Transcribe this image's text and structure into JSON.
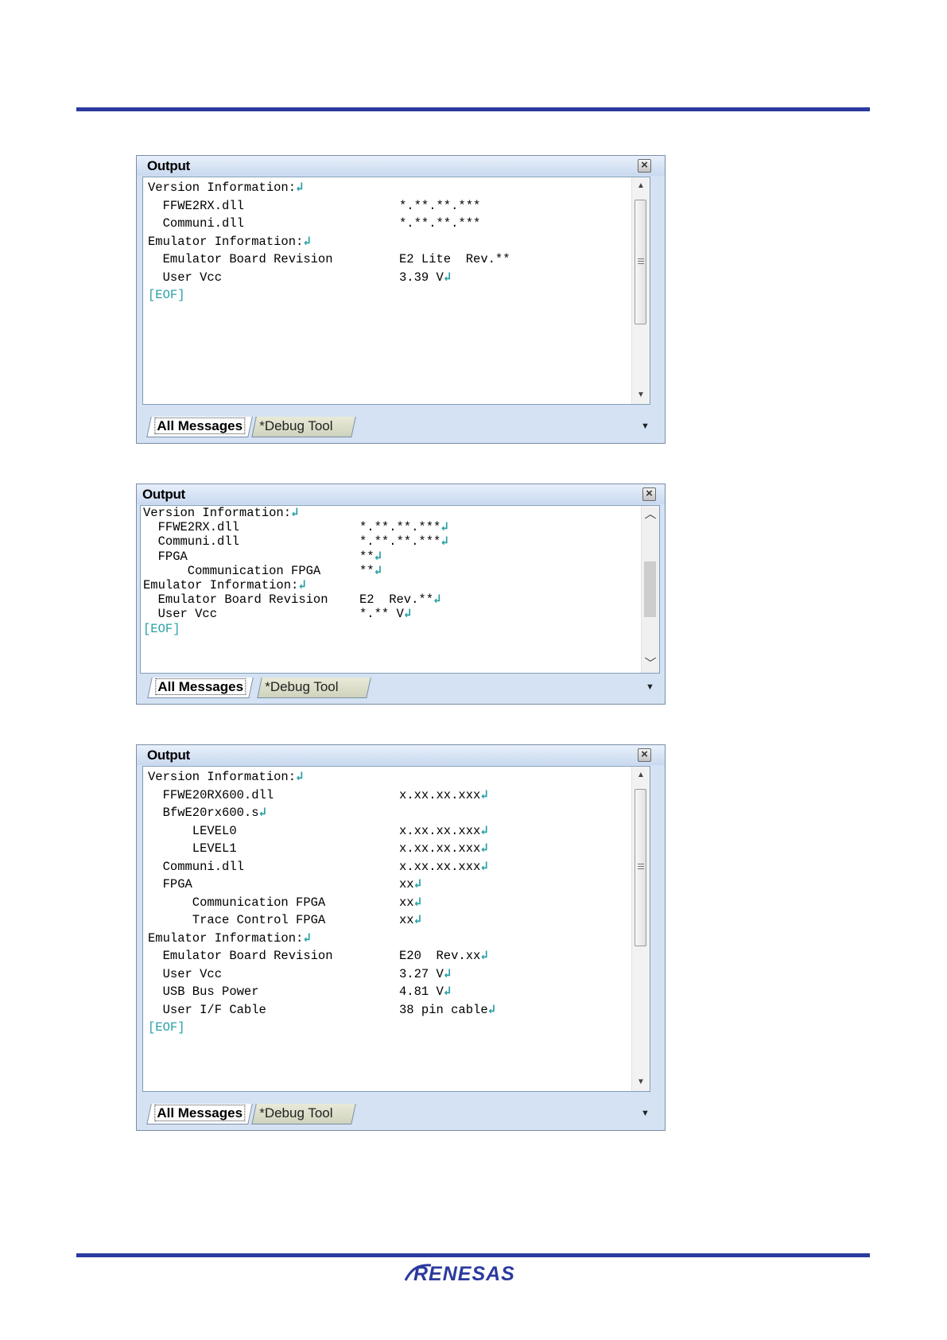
{
  "panels": [
    {
      "title": "Output",
      "lines": [
        {
          "name": "Version Information:",
          "ret": true
        },
        {
          "name": "  FFWE2RX.dll",
          "value": "*.**.**.***",
          "ret": false
        },
        {
          "name": "  Communi.dll",
          "value": "*.**.**.***",
          "ret": false
        },
        {
          "name": "Emulator Information:",
          "ret": true
        },
        {
          "name": "  Emulator Board Revision",
          "value": "E2 Lite  Rev.**",
          "ret": false
        },
        {
          "name": "  User Vcc",
          "value": "3.39 V",
          "ret": true
        }
      ],
      "eof": "[EOF]",
      "tabs": {
        "active": "All Messages",
        "inactive": "*Debug Tool"
      }
    },
    {
      "title": "Output",
      "lines": [
        {
          "name": "Version Information:",
          "ret": true
        },
        {
          "name": "  FFWE2RX.dll",
          "value": "*.**.**.***",
          "ret": true
        },
        {
          "name": "  Communi.dll",
          "value": "*.**.**.***",
          "ret": true
        },
        {
          "name": "  FPGA",
          "value": "**",
          "ret": true
        },
        {
          "name": "      Communication FPGA",
          "value": "**",
          "ret": true
        },
        {
          "name": "Emulator Information:",
          "ret": true
        },
        {
          "name": "  Emulator Board Revision",
          "value": "E2  Rev.**",
          "ret": true
        },
        {
          "name": "  User Vcc",
          "value": "*.** V",
          "ret": true
        }
      ],
      "eof": "[EOF]",
      "tabs": {
        "active": "All Messages",
        "inactive": "*Debug Tool"
      }
    },
    {
      "title": "Output",
      "lines": [
        {
          "name": "Version Information:",
          "ret": true
        },
        {
          "name": "  FFWE20RX600.dll",
          "value": "x.xx.xx.xxx",
          "ret": true
        },
        {
          "name": "  BfwE20rx600.s",
          "ret": true
        },
        {
          "name": "      LEVEL0",
          "value": "x.xx.xx.xxx",
          "ret": true
        },
        {
          "name": "      LEVEL1",
          "value": "x.xx.xx.xxx",
          "ret": true
        },
        {
          "name": "  Communi.dll",
          "value": "x.xx.xx.xxx",
          "ret": true
        },
        {
          "name": "  FPGA",
          "value": "xx",
          "ret": true
        },
        {
          "name": "      Communication FPGA",
          "value": "xx",
          "ret": true
        },
        {
          "name": "      Trace Control FPGA",
          "value": "xx",
          "ret": true
        },
        {
          "name": "Emulator Information:",
          "ret": true
        },
        {
          "name": "  Emulator Board Revision",
          "value": "E20  Rev.xx",
          "ret": true
        },
        {
          "name": "  User Vcc",
          "value": "3.27 V",
          "ret": true
        },
        {
          "name": "  USB Bus Power",
          "value": "4.81 V",
          "ret": true
        },
        {
          "name": "  User I/F Cable",
          "value": "38 pin cable",
          "ret": true
        }
      ],
      "eof": "[EOF]",
      "tabs": {
        "active": "All Messages",
        "inactive": "*Debug Tool"
      }
    }
  ],
  "footer": {
    "logo": "RENESAS",
    "brand_color": "#2b3a9e"
  },
  "icons": {
    "close": "close-icon",
    "return": "return-arrow-icon",
    "scroll_up": "scroll-up-icon",
    "scroll_down": "scroll-down-icon",
    "tab_menu": "chevron-down-icon"
  }
}
